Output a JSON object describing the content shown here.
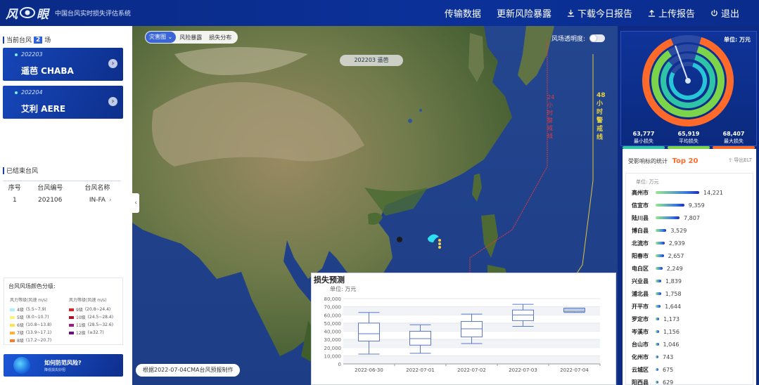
{
  "header": {
    "logo_text_left": "风",
    "logo_text_right": "眼",
    "subtitle": "中国台风实时损失评估系统",
    "nav": [
      {
        "label": "传输数据",
        "icon": ""
      },
      {
        "label": "更新风险暴露",
        "icon": ""
      },
      {
        "label": "下载今日报告",
        "icon": "download-icon"
      },
      {
        "label": "上传报告",
        "icon": "upload-icon"
      },
      {
        "label": "退出",
        "icon": "power-icon"
      }
    ]
  },
  "left": {
    "current_title_prefix": "当前台风",
    "current_count": "2",
    "current_title_suffix": "场",
    "typhoons": [
      {
        "code": "202203",
        "name": "遥芭 CHABA"
      },
      {
        "code": "202204",
        "name": "艾利 AERE"
      }
    ],
    "finished_title": "已结束台风",
    "table_headers": [
      "序号",
      "台风编号",
      "台风名称"
    ],
    "table_rows": [
      [
        "1",
        "202106",
        "IN-FA"
      ]
    ],
    "legend": {
      "title": "台风风场颜色分级:",
      "col_title": "风力等级(风速 m/s)",
      "left": [
        {
          "label": "4级",
          "range": "(5.5~7.9)",
          "color": "#a8f0ff"
        },
        {
          "label": "5级",
          "range": "(8.0~10.7)",
          "color": "#fff27a"
        },
        {
          "label": "6级",
          "range": "(10.8~13.8)",
          "color": "#ffe24a"
        },
        {
          "label": "7级",
          "range": "(13.9~17.1)",
          "color": "#ffb23a"
        },
        {
          "label": "8级",
          "range": "(17.2~20.7)",
          "color": "#ff7a2a"
        }
      ],
      "right": [
        {
          "label": "9级",
          "range": "(20.8~24.4)",
          "color": "#e22020"
        },
        {
          "label": "10级",
          "range": "(24.5~28.4)",
          "color": "#b0122a"
        },
        {
          "label": "11级",
          "range": "(28.5~32.6)",
          "color": "#a0158a"
        },
        {
          "label": "12级",
          "range": "(≥32.7)",
          "color": "#6a0f7a"
        }
      ]
    },
    "promo": {
      "title": "如何防范风险?",
      "sub": "降低损失妙招"
    }
  },
  "map": {
    "tabs": [
      "灾害图",
      "风险暴露",
      "损失分布"
    ],
    "typhoon_label": "202203 遥芭",
    "wind_opacity_label": "风场透明度:",
    "warn24": "24小时警戒线",
    "warn48": "48小时警戒线",
    "forecast_note": "根据2022-07-04CMA台风预报制作"
  },
  "loss": {
    "title": "损失预测",
    "unit": "单位: 万元"
  },
  "chart_data": [
    {
      "type": "box",
      "title": "损失预测",
      "ylabel": "单位: 万元",
      "ylim": [
        0,
        80000
      ],
      "yticks": [
        "0",
        "10,000",
        "20,000",
        "30,000",
        "40,000",
        "50,000",
        "60,000",
        "70,000",
        "80,000"
      ],
      "categories": [
        "2022-06-30",
        "2022-07-01",
        "2022-07-02",
        "2022-07-03",
        "2022-07-04"
      ],
      "series": [
        {
          "x": "2022-06-30",
          "min": 12000,
          "q1": 28000,
          "median": 37000,
          "q3": 50000,
          "max": 63000
        },
        {
          "x": "2022-07-01",
          "min": 13000,
          "q1": 23000,
          "median": 31000,
          "q3": 40000,
          "max": 48000
        },
        {
          "x": "2022-07-02",
          "min": 25000,
          "q1": 33000,
          "median": 43000,
          "q3": 52000,
          "max": 61000
        },
        {
          "x": "2022-07-03",
          "min": 46000,
          "q1": 53000,
          "median": 60000,
          "q3": 66000,
          "max": 73000
        },
        {
          "x": "2022-07-04",
          "min": 63000,
          "q1": 64000,
          "median": 66000,
          "q3": 68000,
          "max": 68400
        }
      ]
    },
    {
      "type": "radial-bar",
      "unit": "单位: 万元",
      "stats": [
        {
          "label": "最小损失",
          "value": "63,777",
          "color": "#2ec4a6"
        },
        {
          "label": "平均损失",
          "value": "65,919",
          "color": "#7bd44a"
        },
        {
          "label": "最大损失",
          "value": "68,407",
          "color": "#ff6a2a"
        }
      ]
    },
    {
      "type": "bar",
      "title": "受影响标的统计",
      "subtitle": "Top 20",
      "unit": "单位: 万元",
      "categories": [
        "高州市",
        "信宜市",
        "陆川县",
        "博白县",
        "北流市",
        "阳春市",
        "电白区",
        "兴业县",
        "浦北县",
        "开平市",
        "罗定市",
        "岑溪市",
        "台山市",
        "化州市",
        "云城区",
        "阳西县"
      ],
      "values": [
        14221,
        9359,
        7807,
        3529,
        2939,
        2657,
        2249,
        1839,
        1758,
        1644,
        1173,
        1156,
        1046,
        743,
        675,
        629
      ],
      "labels": [
        "14,221",
        "9,359",
        "7,807",
        "3,529",
        "2,939",
        "2,657",
        "2,249",
        "1,839",
        "1,758",
        "1,644",
        "1,173",
        "1,156",
        "1,046",
        "743",
        "675",
        "629"
      ]
    }
  ],
  "right": {
    "export_label": "导出ELT"
  }
}
